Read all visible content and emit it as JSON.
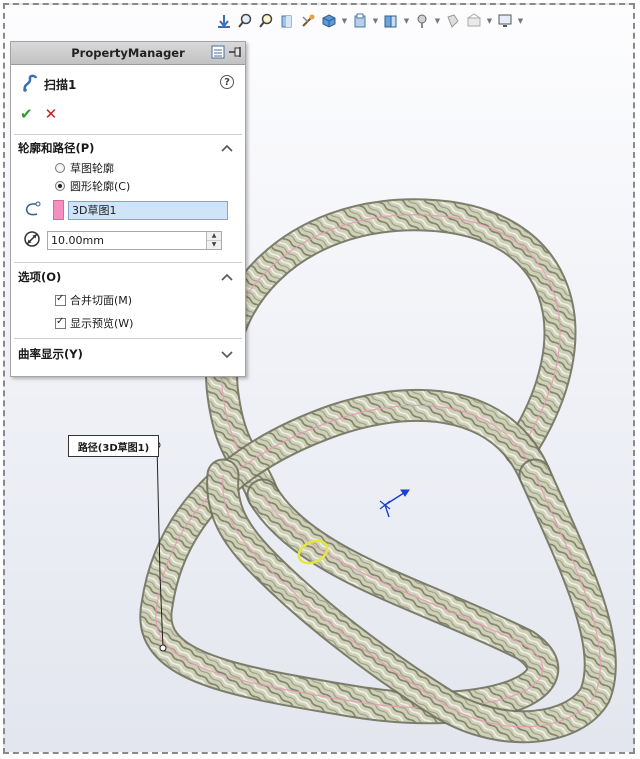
{
  "toolbar": {
    "icons": [
      "view-previous-icon",
      "zoom-to-fit-icon",
      "zoom-area-icon",
      "section-view-icon",
      "view-settings-icon",
      "display-style-icon",
      "hide-show-icon",
      "edit-appearance-icon",
      "apply-scene-icon",
      "lighting-icon",
      "view-orientation-icon",
      "monitor-icon"
    ]
  },
  "property_manager": {
    "title": "PropertyManager",
    "feature_name": "扫描1",
    "help_symbol": "?",
    "ok_symbol": "✔",
    "cancel_symbol": "✕",
    "sections": {
      "profile_path": {
        "title": "轮廓和路径(P)",
        "options": [
          {
            "label": "草图轮廓",
            "selected": false
          },
          {
            "label": "圆形轮廓(C)",
            "selected": true
          }
        ],
        "path_selection": "3D草图1",
        "diameter": "10.00mm"
      },
      "options": {
        "title": "选项(O)",
        "checkboxes": [
          {
            "label": "合并切面(M)",
            "checked": true
          },
          {
            "label": "显示预览(W)",
            "checked": true
          }
        ]
      },
      "curvature": {
        "title": "曲率显示(Y)"
      }
    }
  },
  "callout": {
    "label": "路径(3D草图1)"
  },
  "colors": {
    "selection_swatch": "#f58fc0",
    "selection_box": "#cfe5f7",
    "triad": "#1a3fd0",
    "profile_circle": "#e6e640",
    "ring_base": "#c7c8ae",
    "ring_vein": "#e59ab5"
  }
}
